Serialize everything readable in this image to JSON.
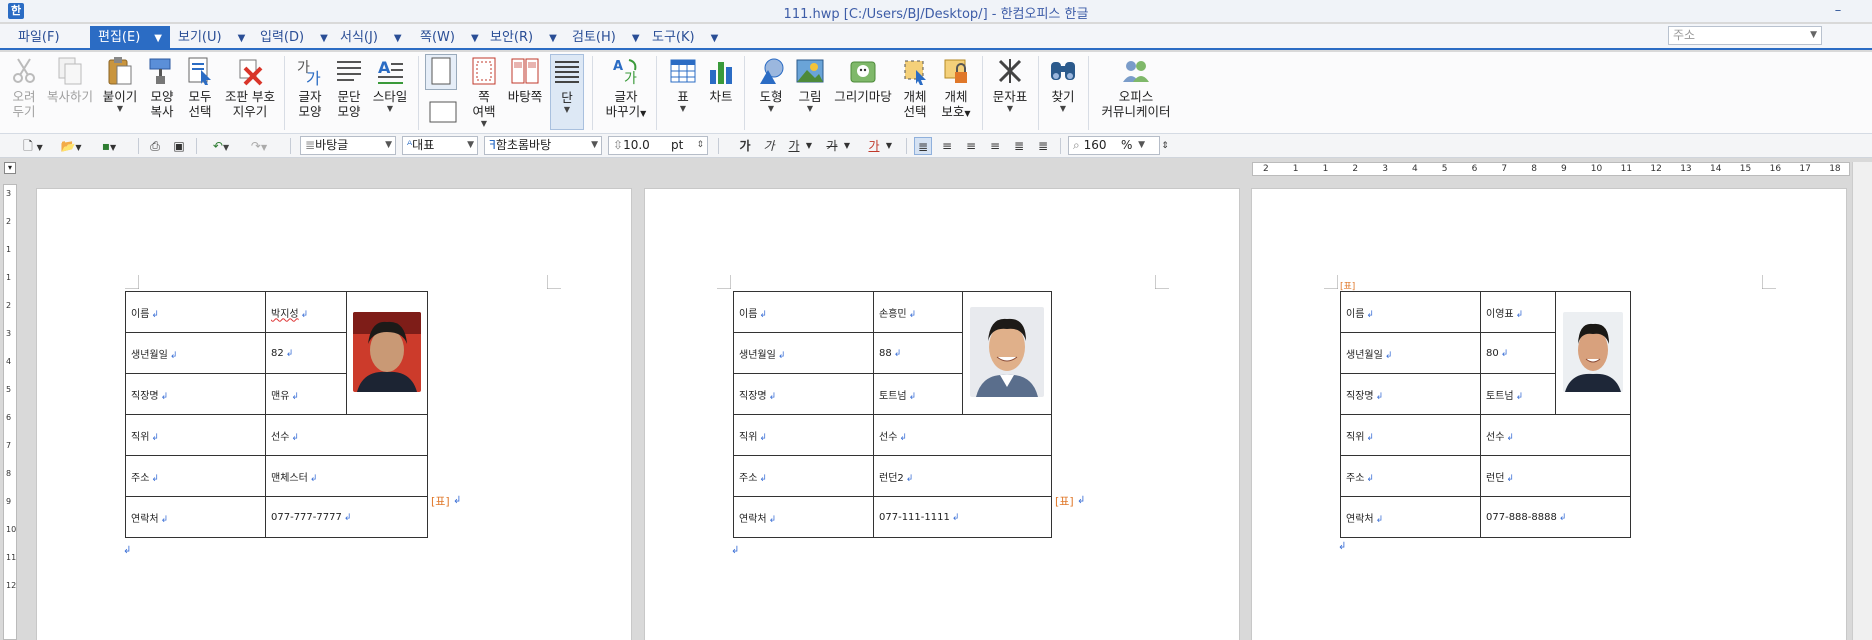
{
  "window": {
    "title": "111.hwp [C:/Users/BJ/Desktop/] - 한컴오피스 한글",
    "app_icon": "한",
    "minimize": "–",
    "restore": "□"
  },
  "menu": {
    "items": [
      {
        "label": "파일(F)"
      },
      {
        "label": "편집(E)"
      },
      {
        "label": "보기(U)"
      },
      {
        "label": "입력(D)"
      },
      {
        "label": "서식(J)"
      },
      {
        "label": "쪽(W)"
      },
      {
        "label": "보안(R)"
      },
      {
        "label": "검토(H)"
      },
      {
        "label": "도구(K)"
      }
    ],
    "dropdown_arrow": "▼",
    "address_placeholder": "주소"
  },
  "ribbon": {
    "buttons": [
      {
        "label1": "오려",
        "label2": "두기",
        "icon": "scissors-icon"
      },
      {
        "label1": "복사하기",
        "label2": "",
        "icon": "copy-icon"
      },
      {
        "label1": "붙이기",
        "label2": "",
        "icon": "paste-icon"
      },
      {
        "label1": "모양",
        "label2": "복사",
        "icon": "format-painter-icon"
      },
      {
        "label1": "모두",
        "label2": "선택",
        "icon": "select-all-icon"
      },
      {
        "label1": "조판 부호",
        "label2": "지우기",
        "icon": "clear-marks-icon"
      },
      {
        "label1": "글자",
        "label2": "모양",
        "icon": "char-shape-icon"
      },
      {
        "label1": "문단",
        "label2": "모양",
        "icon": "paragraph-shape-icon"
      },
      {
        "label1": "스타일",
        "label2": "",
        "icon": "style-icon"
      },
      {
        "label1": "쪽",
        "label2": "여백",
        "icon": "page-margin-icon"
      },
      {
        "label1": "바탕쪽",
        "label2": "",
        "icon": "master-page-icon"
      },
      {
        "label1": "단",
        "label2": "",
        "icon": "column-icon"
      },
      {
        "label1": "글자",
        "label2": "바꾸기",
        "icon": "replace-char-icon"
      },
      {
        "label1": "표",
        "label2": "",
        "icon": "table-icon"
      },
      {
        "label1": "차트",
        "label2": "",
        "icon": "chart-icon"
      },
      {
        "label1": "도형",
        "label2": "",
        "icon": "shape-icon"
      },
      {
        "label1": "그림",
        "label2": "",
        "icon": "picture-icon"
      },
      {
        "label1": "그리기마당",
        "label2": "",
        "icon": "clipart-icon"
      },
      {
        "label1": "개체",
        "label2": "선택",
        "icon": "object-select-icon"
      },
      {
        "label1": "개체",
        "label2": "보호",
        "icon": "object-protect-icon"
      },
      {
        "label1": "문자표",
        "label2": "",
        "icon": "symbol-icon"
      },
      {
        "label1": "찾기",
        "label2": "",
        "icon": "find-icon"
      },
      {
        "label1": "오피스",
        "label2": "커뮤니케이터",
        "icon": "communicator-icon"
      }
    ]
  },
  "format_bar": {
    "style": "바탕글",
    "lang": "대표",
    "font": "함초롬바탕",
    "size": "10.0",
    "size_unit": "pt",
    "zoom": "160",
    "zoom_unit": "%",
    "bold": "가",
    "italic": "가",
    "underline": "가",
    "strike": "가",
    "color": "가"
  },
  "ruler": {
    "ticks": [
      "2",
      "1",
      "1",
      "2",
      "3",
      "4",
      "5",
      "6",
      "7",
      "8",
      "9",
      "10",
      "11",
      "12",
      "13",
      "14",
      "15",
      "16",
      "17",
      "18"
    ]
  },
  "cards": [
    {
      "rows": [
        {
          "label": "이름",
          "value": "박지성"
        },
        {
          "label": "생년월일",
          "value": "82"
        },
        {
          "label": "직장명",
          "value": "맨유"
        },
        {
          "label": "직위",
          "value": "선수"
        },
        {
          "label": "주소",
          "value": "맨체스터"
        },
        {
          "label": "연락처",
          "value": "077-777-7777"
        }
      ]
    },
    {
      "rows": [
        {
          "label": "이름",
          "value": "손흥민"
        },
        {
          "label": "생년월일",
          "value": "88"
        },
        {
          "label": "직장명",
          "value": "토트넘"
        },
        {
          "label": "직위",
          "value": "선수"
        },
        {
          "label": "주소",
          "value": "런던2"
        },
        {
          "label": "연락처",
          "value": "077-111-1111"
        }
      ]
    },
    {
      "rows": [
        {
          "label": "이름",
          "value": "이영표"
        },
        {
          "label": "생년월일",
          "value": "80"
        },
        {
          "label": "직장명",
          "value": "토트넘"
        },
        {
          "label": "직위",
          "value": "선수"
        },
        {
          "label": "주소",
          "value": "런던"
        },
        {
          "label": "연락처",
          "value": "077-888-8888"
        }
      ]
    }
  ],
  "marks": {
    "table_mark": "[표]",
    "return": "↲"
  }
}
